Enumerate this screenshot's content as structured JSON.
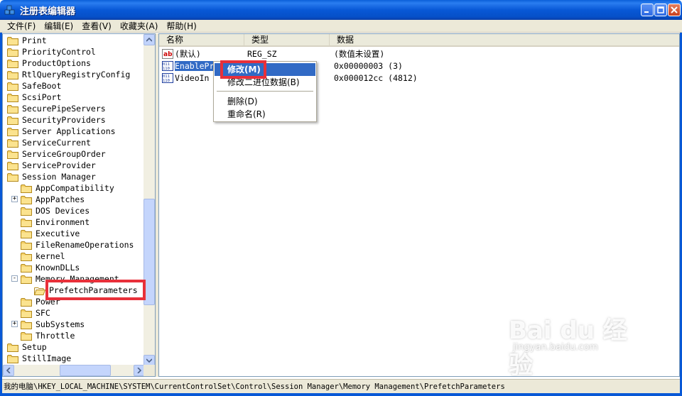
{
  "window": {
    "title": "注册表编辑器"
  },
  "menubar": [
    "文件(F)",
    "编辑(E)",
    "查看(V)",
    "收藏夹(A)",
    "帮助(H)"
  ],
  "tree": {
    "items": [
      {
        "label": "Print",
        "level": 0,
        "expander": ""
      },
      {
        "label": "PriorityControl",
        "level": 0,
        "expander": ""
      },
      {
        "label": "ProductOptions",
        "level": 0,
        "expander": ""
      },
      {
        "label": "RtlQueryRegistryConfig",
        "level": 0,
        "expander": ""
      },
      {
        "label": "SafeBoot",
        "level": 0,
        "expander": ""
      },
      {
        "label": "ScsiPort",
        "level": 0,
        "expander": ""
      },
      {
        "label": "SecurePipeServers",
        "level": 0,
        "expander": ""
      },
      {
        "label": "SecurityProviders",
        "level": 0,
        "expander": ""
      },
      {
        "label": "Server Applications",
        "level": 0,
        "expander": ""
      },
      {
        "label": "ServiceCurrent",
        "level": 0,
        "expander": ""
      },
      {
        "label": "ServiceGroupOrder",
        "level": 0,
        "expander": ""
      },
      {
        "label": "ServiceProvider",
        "level": 0,
        "expander": ""
      },
      {
        "label": "Session Manager",
        "level": 0,
        "expander": ""
      },
      {
        "label": "AppCompatibility",
        "level": 1,
        "expander": ""
      },
      {
        "label": "AppPatches",
        "level": 1,
        "expander": "+"
      },
      {
        "label": "DOS Devices",
        "level": 1,
        "expander": ""
      },
      {
        "label": "Environment",
        "level": 1,
        "expander": ""
      },
      {
        "label": "Executive",
        "level": 1,
        "expander": ""
      },
      {
        "label": "FileRenameOperations",
        "level": 1,
        "expander": ""
      },
      {
        "label": "kernel",
        "level": 1,
        "expander": ""
      },
      {
        "label": "KnownDLLs",
        "level": 1,
        "expander": ""
      },
      {
        "label": "Memory Management",
        "level": 1,
        "expander": "-"
      },
      {
        "label": "PrefetchParameters",
        "level": 2,
        "expander": ""
      },
      {
        "label": "Power",
        "level": 1,
        "expander": ""
      },
      {
        "label": "SFC",
        "level": 1,
        "expander": ""
      },
      {
        "label": "SubSystems",
        "level": 1,
        "expander": "+"
      },
      {
        "label": "Throttle",
        "level": 1,
        "expander": ""
      },
      {
        "label": "Setup",
        "level": 0,
        "expander": ""
      },
      {
        "label": "StillImage",
        "level": 0,
        "expander": ""
      }
    ]
  },
  "list": {
    "columns": [
      "名称",
      "类型",
      "数据"
    ],
    "rows": [
      {
        "name": "(默认)",
        "type": "REG_SZ",
        "data": "(数值未设置)",
        "icon": "ab-string-icon"
      },
      {
        "name": "EnablePr",
        "type": "",
        "data": "0x00000003 (3)",
        "icon": "binary-dword-icon"
      },
      {
        "name": "VideoIn",
        "type": "",
        "data": "0x000012cc (4812)",
        "icon": "binary-dword-icon"
      }
    ]
  },
  "context_menu": {
    "items": [
      "修改(M)",
      "修改二进位数据(B)",
      "删除(D)",
      "重命名(R)"
    ]
  },
  "statusbar": {
    "path": "我的电脑\\HKEY_LOCAL_MACHINE\\SYSTEM\\CurrentControlSet\\Control\\Session Manager\\Memory Management\\PrefetchParameters"
  },
  "watermark": {
    "logo": "Bai du 经验",
    "url": "jingyan.baidu.com"
  },
  "colors": {
    "titlebar": "#0858d6",
    "selection": "#316ac5",
    "highlight_box": "#e8303a"
  }
}
